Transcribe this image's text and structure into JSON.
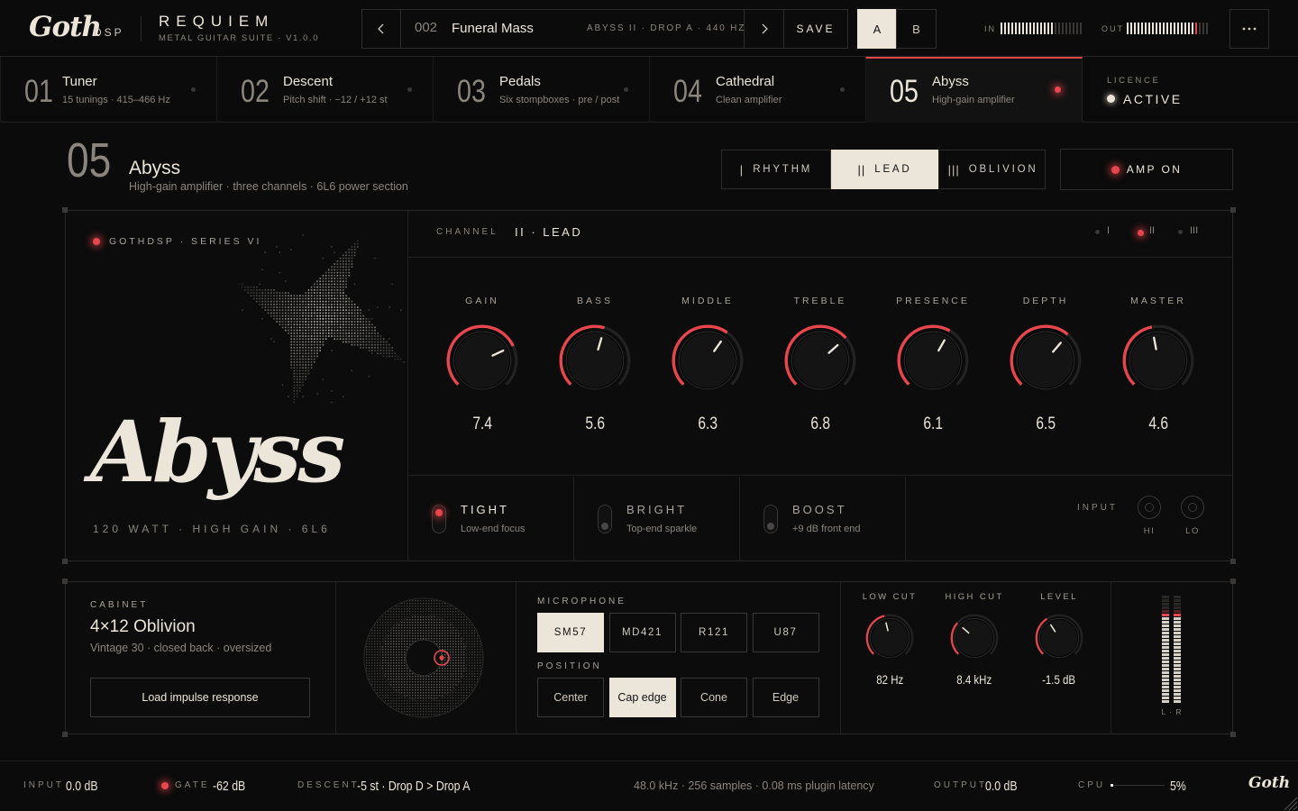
{
  "brand": {
    "logo": "Goth",
    "sub": "DSP"
  },
  "product": {
    "name": "REQUIEM",
    "subtitle": "METAL GUITAR SUITE · V1.0.0"
  },
  "preset": {
    "number": "002",
    "name": "Funeral Mass",
    "meta": "ABYSS II · DROP A · 440 HZ",
    "save_label": "SAVE",
    "slot_a": "A",
    "slot_b": "B"
  },
  "meters": {
    "in_label": "IN",
    "out_label": "OUT"
  },
  "modules": [
    {
      "num": "01",
      "name": "Tuner",
      "desc": "15 tunings · 415–466 Hz",
      "active": false
    },
    {
      "num": "02",
      "name": "Descent",
      "desc": "Pitch shift · −12 / +12 st",
      "active": false
    },
    {
      "num": "03",
      "name": "Pedals",
      "desc": "Six stompboxes · pre / post",
      "active": false
    },
    {
      "num": "04",
      "name": "Cathedral",
      "desc": "Clean amplifier",
      "active": false
    },
    {
      "num": "05",
      "name": "Abyss",
      "desc": "High-gain amplifier",
      "active": true
    }
  ],
  "licence": {
    "label": "LICENCE",
    "status": "ACTIVE"
  },
  "amp": {
    "num": "05",
    "name": "Abyss",
    "desc": "High-gain amplifier · three channels · 6L6 power section",
    "channels": [
      {
        "label": "RHYTHM",
        "mark": "|",
        "selected": false
      },
      {
        "label": "LEAD",
        "mark": "||",
        "selected": true
      },
      {
        "label": "OBLIVION",
        "mark": "|||",
        "selected": false
      }
    ],
    "power_label": "AMP ON",
    "series": "GOTHDSP · SERIES VI",
    "logo": "Abyss",
    "spec": "120 WATT · HIGH GAIN · 6L6",
    "channel_label": "CHANNEL",
    "channel_value": "II · LEAD",
    "channel_indicators": [
      "I",
      "II",
      "III"
    ],
    "channel_active_index": 1,
    "knobs": [
      {
        "label": "GAIN",
        "value": "7.4",
        "level": 0.74
      },
      {
        "label": "BASS",
        "value": "5.6",
        "level": 0.56
      },
      {
        "label": "MIDDLE",
        "value": "6.3",
        "level": 0.63
      },
      {
        "label": "TREBLE",
        "value": "6.8",
        "level": 0.68
      },
      {
        "label": "PRESENCE",
        "value": "6.1",
        "level": 0.61
      },
      {
        "label": "DEPTH",
        "value": "6.5",
        "level": 0.65
      },
      {
        "label": "MASTER",
        "value": "4.6",
        "level": 0.46
      }
    ],
    "switches": [
      {
        "label": "TIGHT",
        "desc": "Low-end focus",
        "on": true
      },
      {
        "label": "BRIGHT",
        "desc": "Top-end sparkle",
        "on": false
      },
      {
        "label": "BOOST",
        "desc": "+9 dB front end",
        "on": false
      }
    ],
    "input_label": "INPUT",
    "input_hi": "HI",
    "input_lo": "LO"
  },
  "cabinet": {
    "label": "CABINET",
    "name": "4×12 Oblivion",
    "desc": "Vintage 30 · closed back · oversized",
    "load_button": "Load impulse response",
    "mic_label": "MICROPHONE",
    "mics": [
      "SM57",
      "MD421",
      "R121",
      "U87"
    ],
    "mic_selected": 0,
    "position_label": "POSITION",
    "positions": [
      "Center",
      "Cap edge",
      "Cone",
      "Edge"
    ],
    "position_selected": 1,
    "eq": [
      {
        "label": "LOW CUT",
        "value": "82 Hz",
        "level": 0.45
      },
      {
        "label": "HIGH CUT",
        "value": "8.4 kHz",
        "level": 0.32
      },
      {
        "label": "LEVEL",
        "value": "-1.5 dB",
        "level": 0.38
      }
    ],
    "meter_label": "L · R"
  },
  "status": {
    "input_label": "INPUT",
    "input_value": "0.0 dB",
    "gate_label": "GATE",
    "gate_value": "-62 dB",
    "descent_label": "DESCENT",
    "descent_value": "-5 st · Drop D > Drop A",
    "info": "48.0 kHz · 256 samples · 0.08 ms plugin latency",
    "output_label": "OUTPUT",
    "output_value": "0.0 dB",
    "cpu_label": "CPU",
    "cpu_value": "5%",
    "cpu_level": 0.05,
    "logo": "Goth"
  },
  "colors": {
    "accent": "#e8454d",
    "bg": "#0b0b0b",
    "panel": "#0e0e0e",
    "cream": "#ece6da"
  }
}
